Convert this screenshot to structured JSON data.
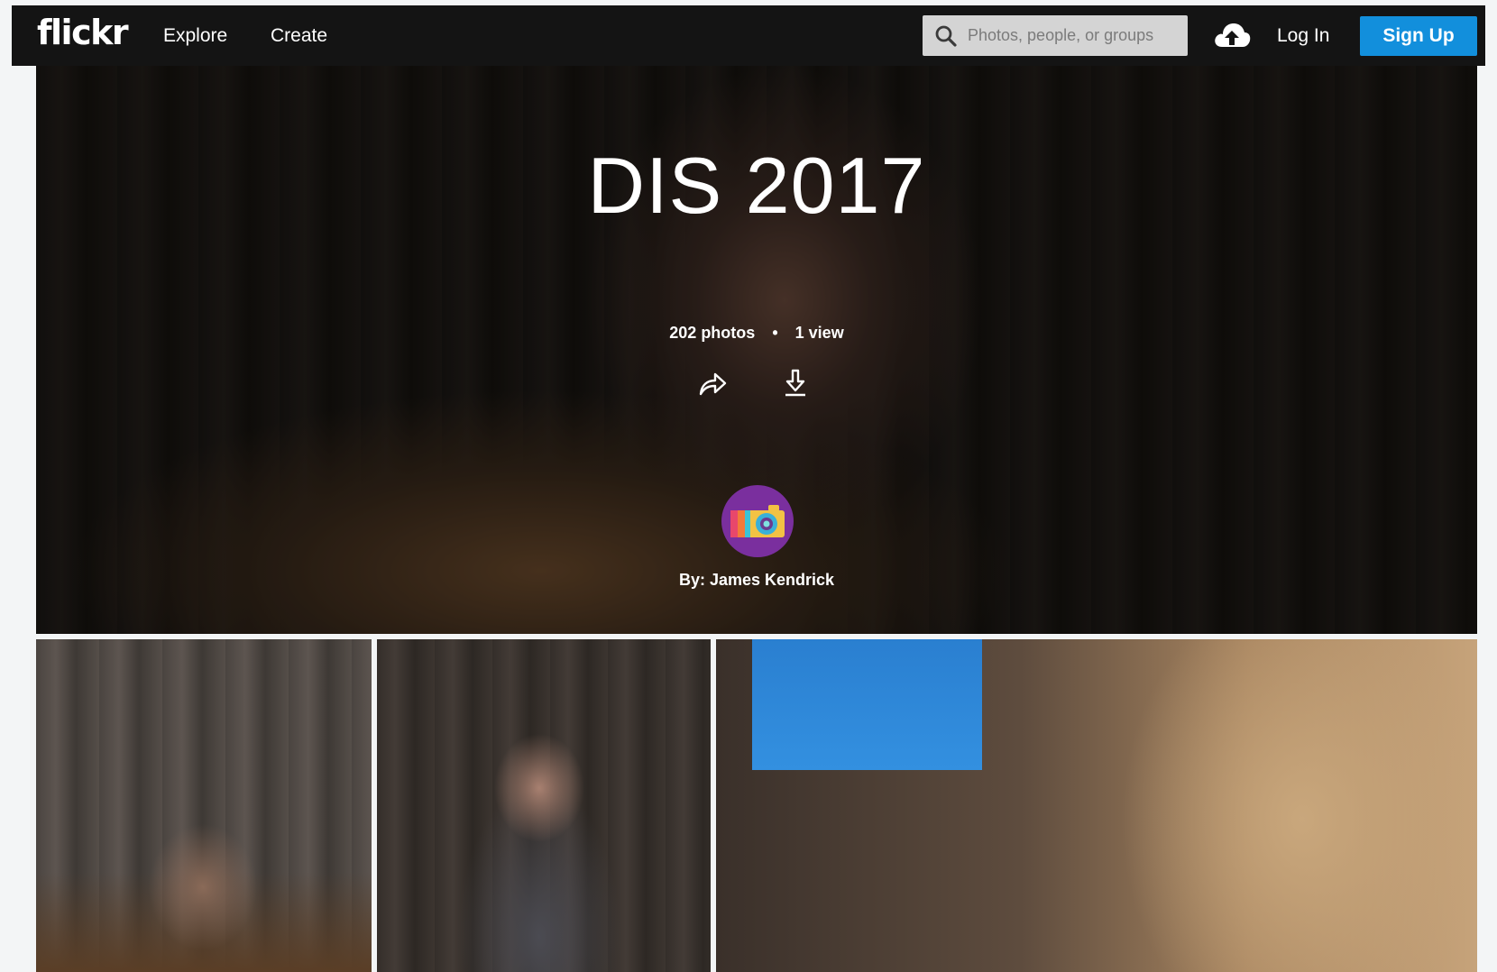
{
  "nav": {
    "logo": "flickr",
    "explore_label": "Explore",
    "create_label": "Create",
    "search_placeholder": "Photos, people, or groups",
    "upload_icon": "cloud-upload-icon",
    "login_label": "Log In",
    "signup_label": "Sign Up"
  },
  "album": {
    "title": "DIS 2017",
    "photo_count": "202 photos",
    "separator": "•",
    "view_count": "1 view",
    "share_icon": "share-arrow-icon",
    "download_icon": "download-icon",
    "author_line": "By: James Kendrick"
  },
  "colors": {
    "nav_background": "#141414",
    "signup_button": "#128fdc",
    "avatar_background": "#7a2f9e"
  }
}
